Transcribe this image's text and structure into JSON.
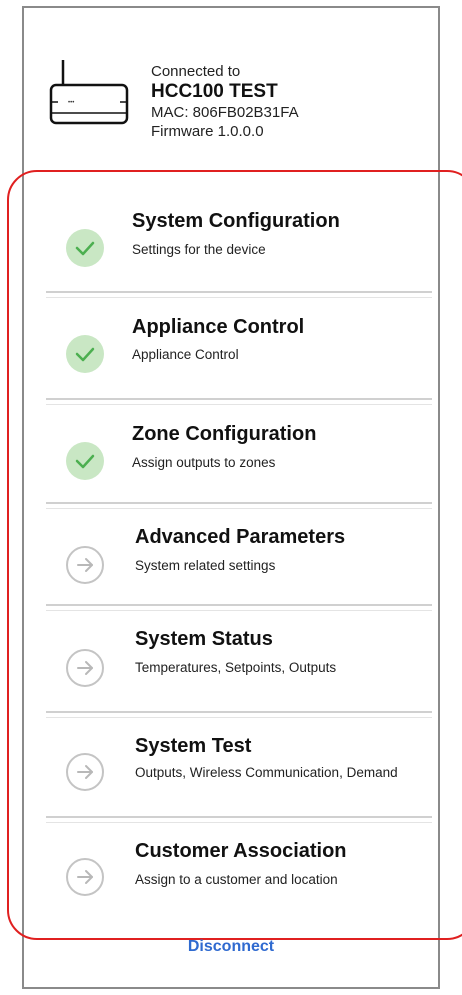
{
  "device": {
    "connected_label": "Connected to",
    "name": "HCC100 TEST",
    "mac": "MAC: 806FB02B31FA",
    "firmware": "Firmware 1.0.0.0"
  },
  "menu": [
    {
      "title": "System Configuration",
      "subtitle": "Settings for the device",
      "status": "complete"
    },
    {
      "title": "Appliance Control",
      "subtitle": "Appliance Control",
      "status": "complete"
    },
    {
      "title": "Zone Configuration",
      "subtitle": "Assign outputs to zones",
      "status": "complete"
    },
    {
      "title": "Advanced Parameters",
      "subtitle": "System related settings",
      "status": "pending"
    },
    {
      "title": "System Status",
      "subtitle": "Temperatures, Setpoints, Outputs",
      "status": "pending"
    },
    {
      "title": "System Test",
      "subtitle": "Outputs, Wireless Communication, Demand",
      "status": "pending"
    },
    {
      "title": "Customer Association",
      "subtitle": "Assign to a customer and location",
      "status": "pending"
    }
  ],
  "actions": {
    "disconnect_label": "Disconnect"
  },
  "colors": {
    "check_green": "#4caf50",
    "check_bg": "#c9e7c4",
    "link_blue": "#2f6ad0",
    "highlight_red": "#e02020"
  }
}
